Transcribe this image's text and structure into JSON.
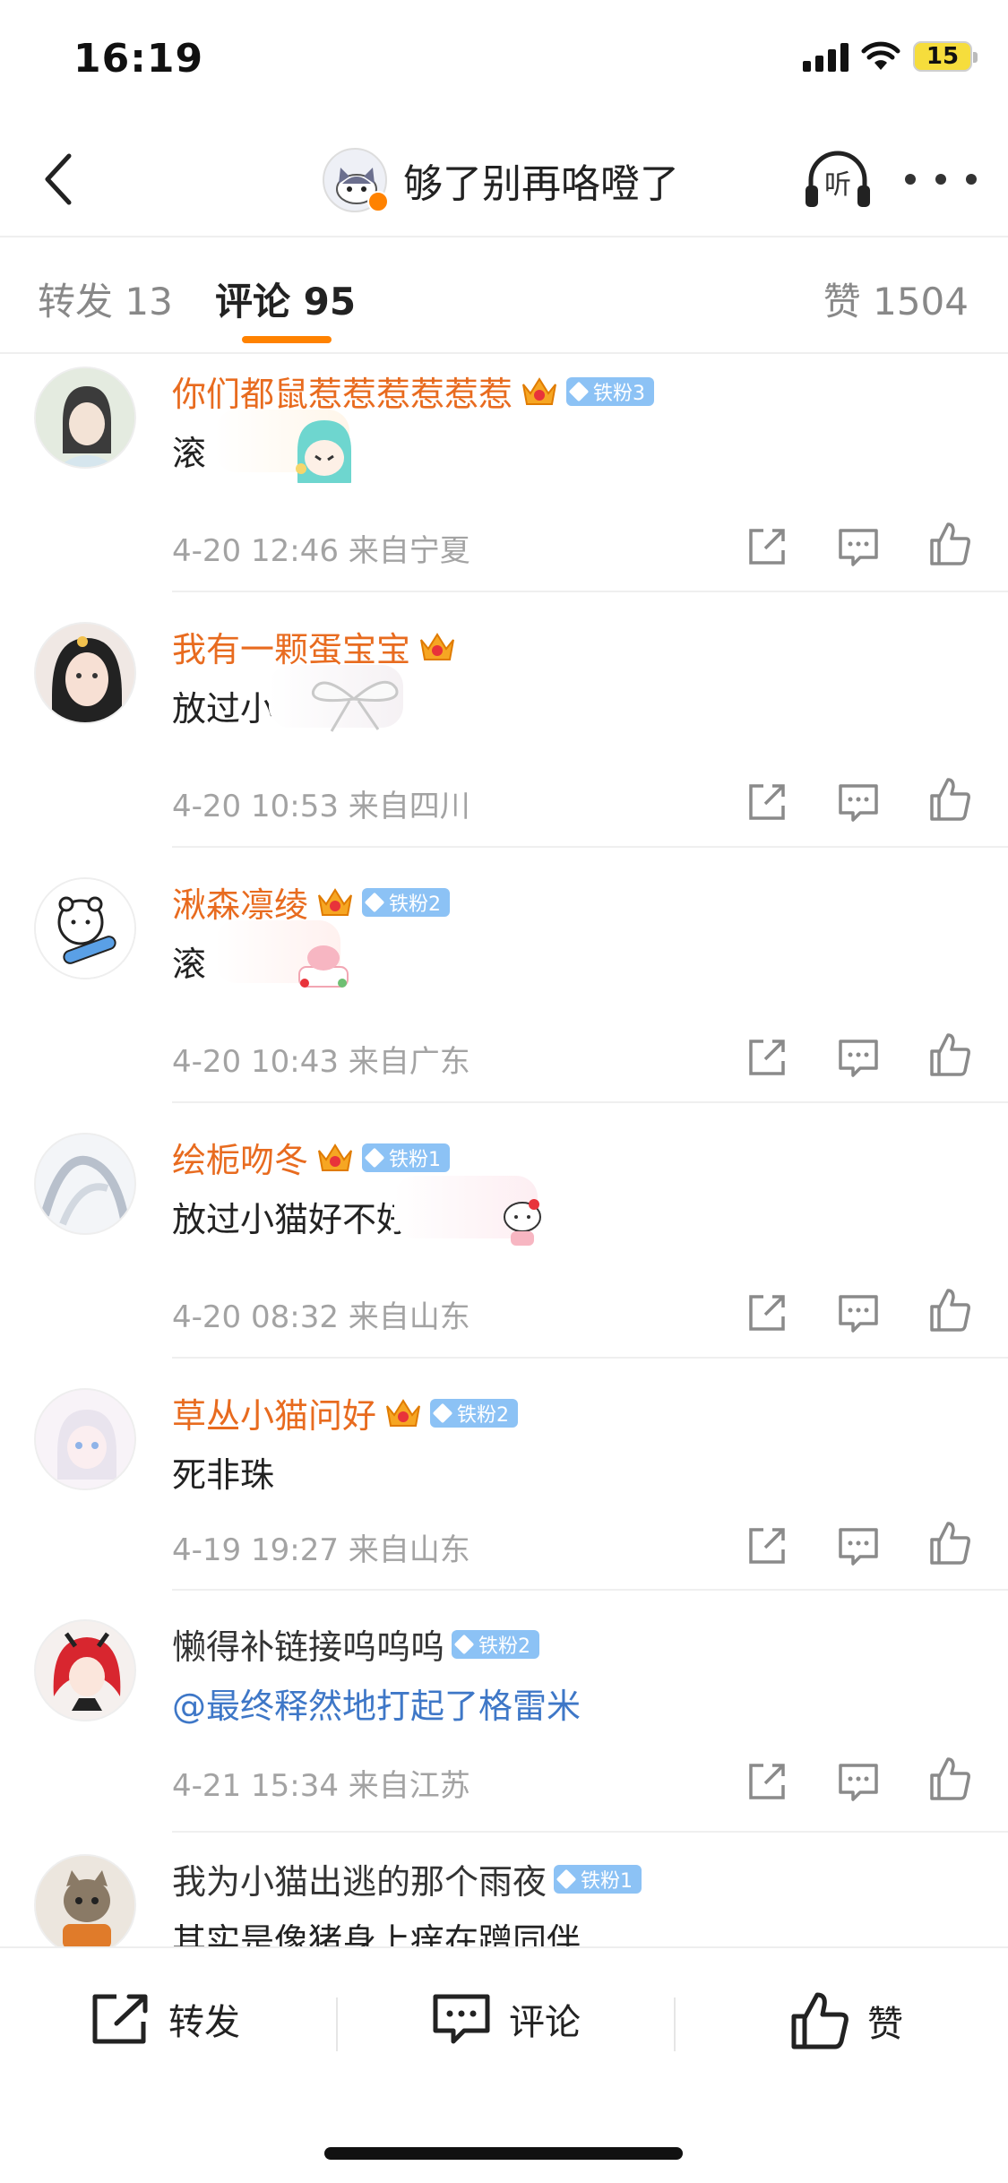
{
  "status": {
    "time": "16:19",
    "battery": "15"
  },
  "nav": {
    "title": "够了别再咯噔了",
    "listen_label": "听"
  },
  "tabs": {
    "repost": "转发 13",
    "comment": "评论 95",
    "like": "赞 1504"
  },
  "comments": [
    {
      "username": "你们都鼠惹惹惹惹惹惹",
      "vip": true,
      "crown": true,
      "fan_badge": "铁粉3",
      "text": "滚",
      "meta": "4-20 12:46  来自宁夏"
    },
    {
      "username": "我有一颗蛋宝宝",
      "vip": true,
      "crown": true,
      "fan_badge": "",
      "text": "放过小猫",
      "meta": "4-20 10:53  来自四川"
    },
    {
      "username": "湫森凛绫",
      "vip": true,
      "crown": true,
      "fan_badge": "铁粉2",
      "text": "滚",
      "meta": "4-20 10:43  来自广东"
    },
    {
      "username": "绘栀吻冬",
      "vip": true,
      "crown": true,
      "fan_badge": "铁粉1",
      "text": "放过小猫好不好?",
      "meta": "4-20 08:32  来自山东"
    },
    {
      "username": "草丛小猫问好",
      "vip": true,
      "crown": true,
      "fan_badge": "铁粉2",
      "text": "死非珠",
      "meta": "4-19 19:27  来自山东"
    },
    {
      "username": "懒得补链接呜呜呜",
      "vip": false,
      "crown": false,
      "fan_badge": "铁粉2",
      "text": "@最终释然地打起了格雷米",
      "meta": "4-21 15:34  来自江苏"
    },
    {
      "username": "我为小猫出逃的那个雨夜",
      "vip": false,
      "crown": false,
      "fan_badge": "铁粉1",
      "text": "其实是像猪身上痒在蹭同伴",
      "meta": ""
    }
  ],
  "bottom": {
    "repost": "转发",
    "comment": "评论",
    "like": "赞"
  },
  "colors": {
    "accent": "#ff8200",
    "vip_name": "#e86b1f",
    "link": "#3e77c7",
    "fan_badge": "#8cc2f5"
  }
}
